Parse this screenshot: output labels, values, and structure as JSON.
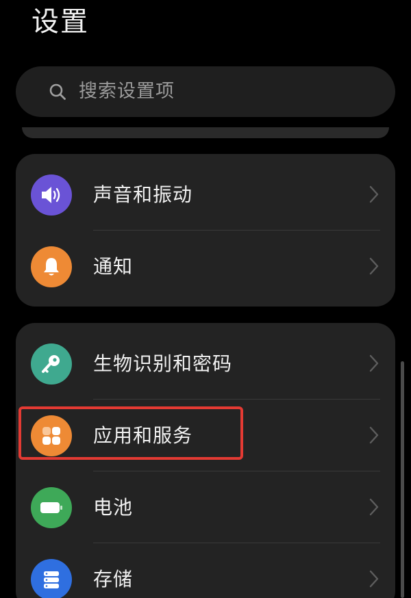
{
  "header": {
    "title": "设置"
  },
  "search": {
    "placeholder": "搜索设置项",
    "icon": "search-icon"
  },
  "groups": [
    {
      "items": [
        {
          "label": "声音和振动",
          "icon": "speaker-icon",
          "icon_bg": "#6a53d6"
        },
        {
          "label": "通知",
          "icon": "bell-icon",
          "icon_bg": "#ee8a35"
        }
      ]
    },
    {
      "items": [
        {
          "label": "生物识别和密码",
          "icon": "key-icon",
          "icon_bg": "#3fa98f"
        },
        {
          "label": "应用和服务",
          "icon": "apps-grid-icon",
          "icon_bg": "#ee8a35",
          "highlighted": true
        },
        {
          "label": "电池",
          "icon": "battery-icon",
          "icon_bg": "#3ea958"
        },
        {
          "label": "存储",
          "icon": "storage-icon",
          "icon_bg": "#2f6fe0"
        }
      ]
    }
  ],
  "colors": {
    "background": "#000000",
    "card": "#232323",
    "highlight": "#e33a33"
  }
}
